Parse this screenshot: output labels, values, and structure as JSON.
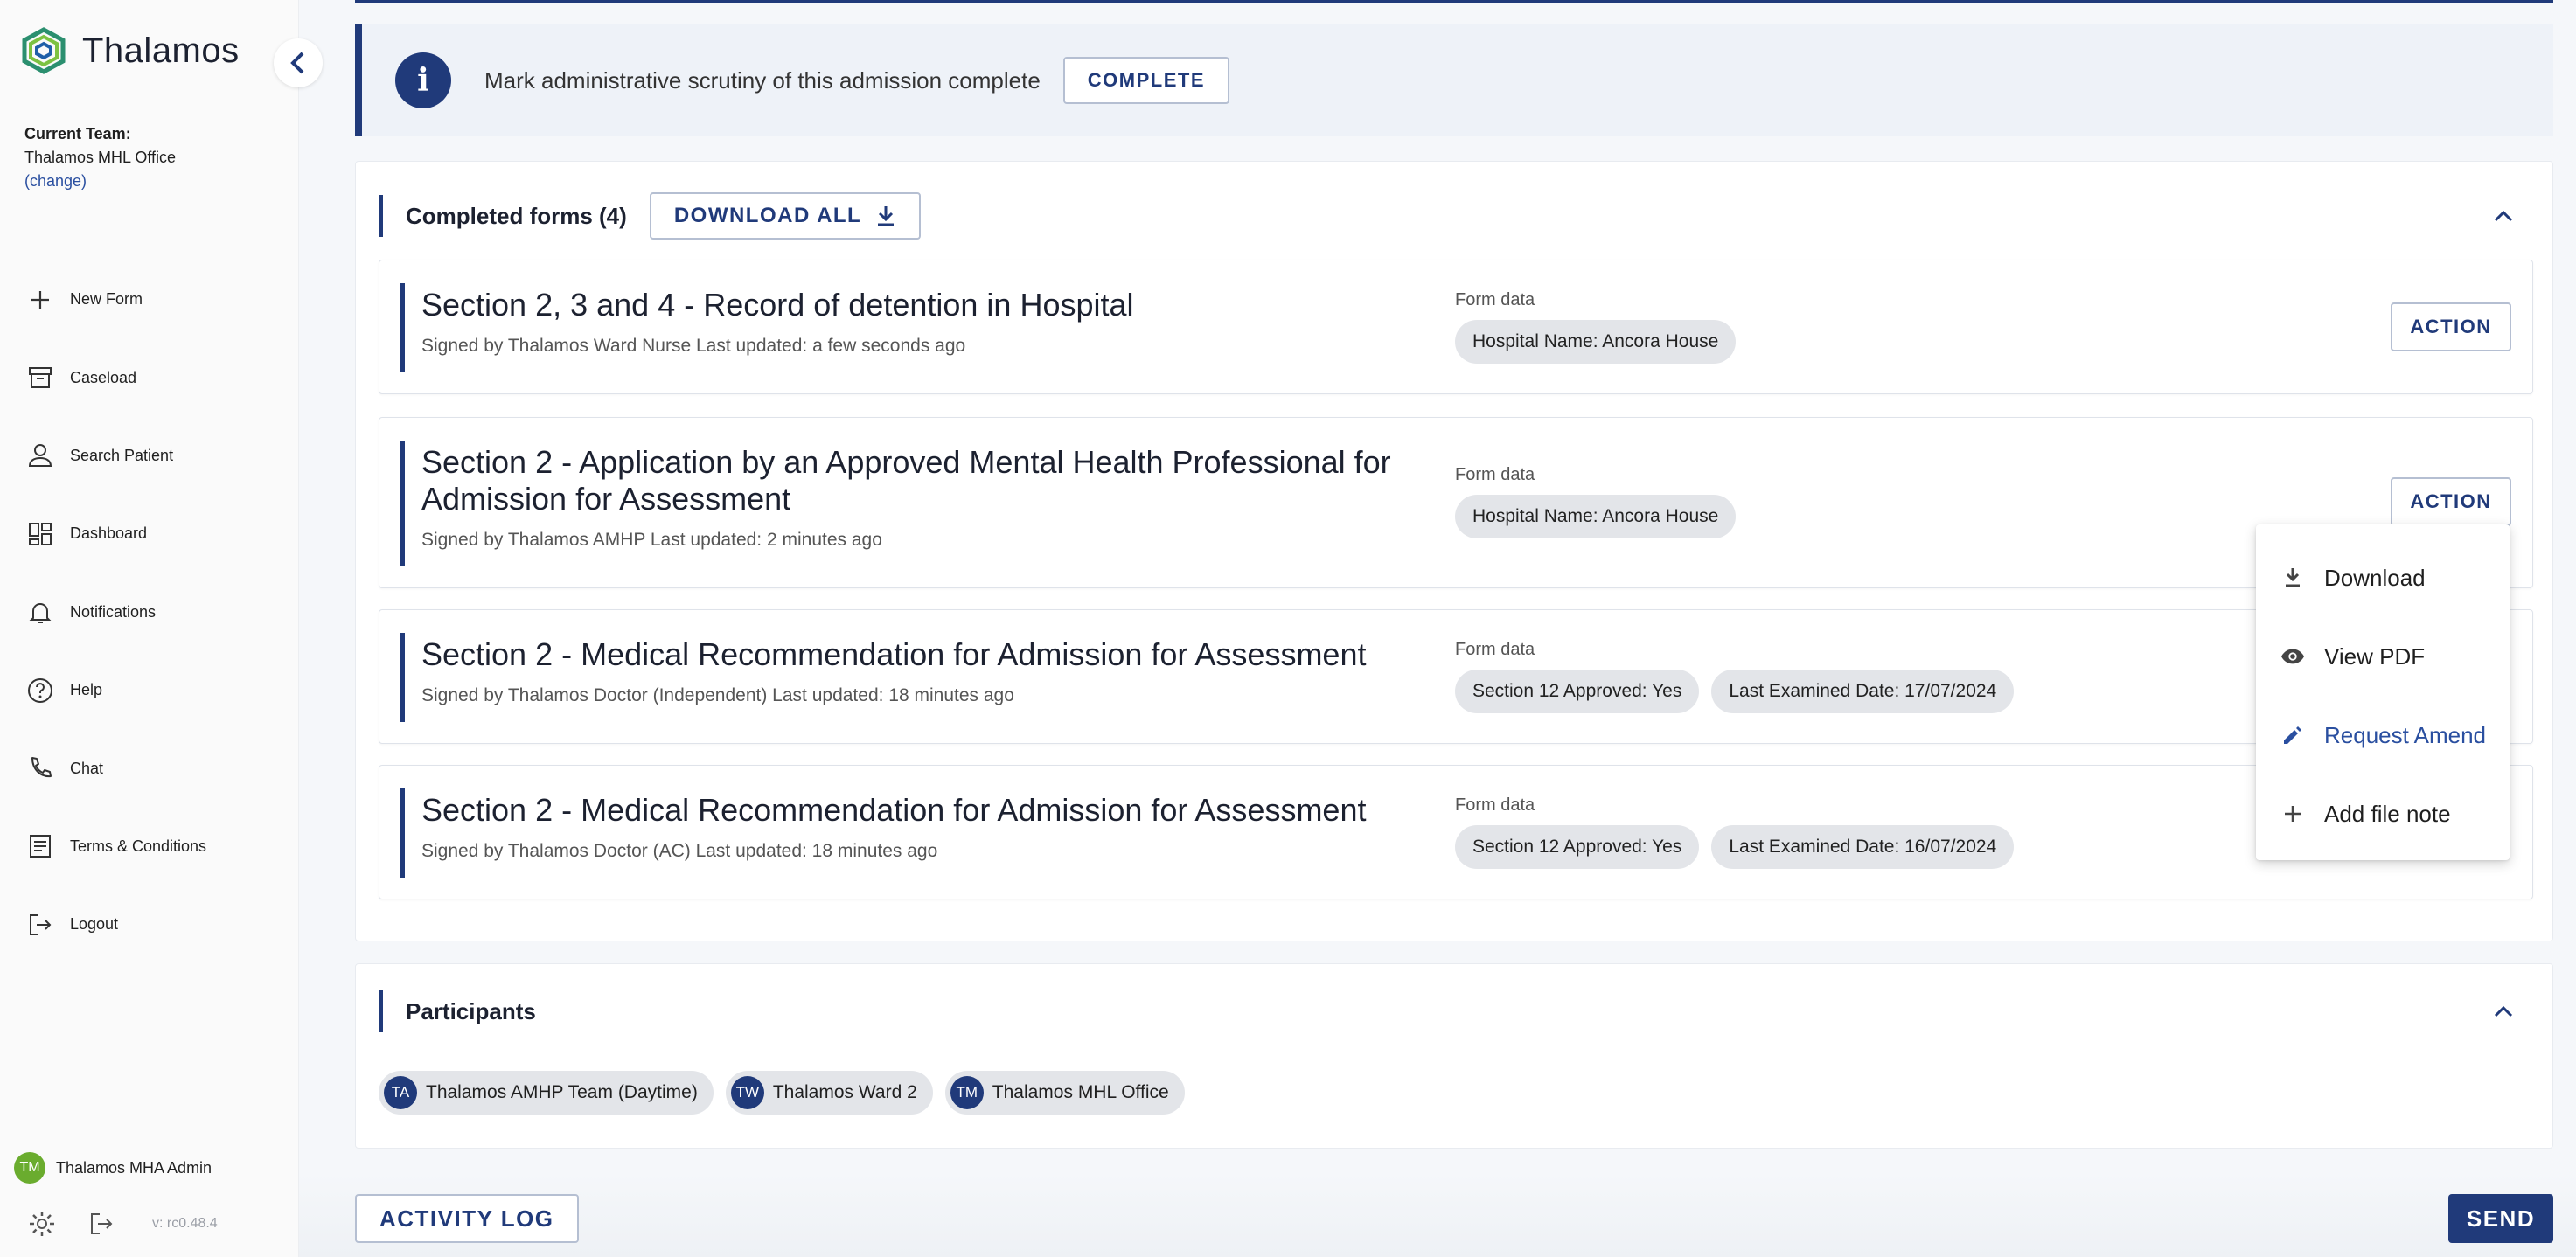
{
  "brand": {
    "name": "Thalamos"
  },
  "team": {
    "label": "Current Team:",
    "name": "Thalamos MHL Office",
    "change": "(change)"
  },
  "nav": [
    {
      "label": "New Form",
      "icon": "plus-icon"
    },
    {
      "label": "Caseload",
      "icon": "archive-icon"
    },
    {
      "label": "Search Patient",
      "icon": "person-icon"
    },
    {
      "label": "Dashboard",
      "icon": "dashboard-icon"
    },
    {
      "label": "Notifications",
      "icon": "bell-icon"
    },
    {
      "label": "Help",
      "icon": "help-icon"
    },
    {
      "label": "Chat",
      "icon": "phone-icon"
    },
    {
      "label": "Terms & Conditions",
      "icon": "document-icon"
    },
    {
      "label": "Logout",
      "icon": "logout-icon"
    }
  ],
  "user": {
    "initials": "TM",
    "name": "Thalamos MHA Admin",
    "version": "v: rc0.48.4"
  },
  "notice": {
    "icon": "i",
    "text": "Mark administrative scrutiny of this admission complete",
    "button": "COMPLETE"
  },
  "completed": {
    "title": "Completed forms (4)",
    "download_all": "DOWNLOAD ALL",
    "form_data_label": "Form data",
    "action_label": "ACTION",
    "forms": [
      {
        "title": "Section 2, 3 and 4 - Record of detention in Hospital",
        "signed": "Signed by Thalamos Ward Nurse Last updated: a few seconds ago",
        "chips": [
          "Hospital Name: Ancora House"
        ]
      },
      {
        "title": "Section 2 - Application by an Approved Mental Health Professional for Admission for Assessment",
        "signed": "Signed by Thalamos AMHP Last updated: 2 minutes ago",
        "chips": [
          "Hospital Name: Ancora House"
        ]
      },
      {
        "title": "Section 2 - Medical Recommendation for Admission for Assessment",
        "signed": "Signed by Thalamos Doctor (Independent) Last updated: 18 minutes ago",
        "chips": [
          "Section 12 Approved: Yes",
          "Last Examined Date: 17/07/2024"
        ]
      },
      {
        "title": "Section 2 - Medical Recommendation for Admission for Assessment",
        "signed": "Signed by Thalamos Doctor (AC) Last updated: 18 minutes ago",
        "chips": [
          "Section 12 Approved: Yes",
          "Last Examined Date: 16/07/2024"
        ]
      }
    ]
  },
  "participants": {
    "title": "Participants",
    "items": [
      {
        "initials": "TA",
        "name": "Thalamos AMHP Team (Daytime)"
      },
      {
        "initials": "TW",
        "name": "Thalamos Ward 2"
      },
      {
        "initials": "TM",
        "name": "Thalamos MHL Office"
      }
    ]
  },
  "menu": [
    {
      "label": "Download",
      "icon": "download-icon"
    },
    {
      "label": "View PDF",
      "icon": "eye-icon"
    },
    {
      "label": "Request Amend",
      "icon": "pencil-icon"
    },
    {
      "label": "Add file note",
      "icon": "plus-icon"
    }
  ],
  "footer": {
    "activity_log": "ACTIVITY LOG",
    "send": "SEND"
  },
  "colors": {
    "primary": "#203a7a",
    "link": "#2a4fa0",
    "user_avatar": "#6aac2e",
    "chip": "#e3e5e9"
  }
}
